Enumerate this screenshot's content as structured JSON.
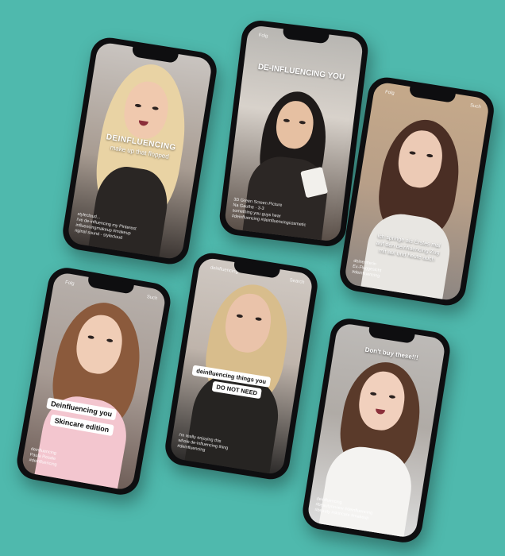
{
  "background_color": "#4fb9ad",
  "phones": [
    {
      "topbar": "",
      "title": "DEINFLUENCING",
      "subtitle": "make up that flopped",
      "caption": [
        "styleclaud...",
        "i've de-influencing my Pinterest",
        "influencingmakeup #makeup",
        "riginal sound - stylecloud"
      ]
    },
    {
      "topbar": "Folg",
      "title": "DE-INFLUENCING YOU",
      "caption": [
        "3D Green Screen Picture",
        "Na Gauthe · 3-3",
        "something you guys hear",
        "#deinfluencing #deinfluencingcosmetic"
      ]
    },
    {
      "topbar": "Folg",
      "topbar_right": "Such",
      "caption_text": [
        "ich springe als Erstes mal",
        "auf den deinfluencing Zug",
        "mit auf und heute auch"
      ],
      "caption": [
        "deineritterin",
        "Ex-Fluggesicht",
        "#deinfluencing"
      ]
    },
    {
      "topbar": "Folg",
      "topbar_right": "Such",
      "chips": [
        "Deinfluencing you",
        "Skincare edition"
      ],
      "caption": [
        "deinfluencing",
        "Paula Resale",
        "#deinfluencing"
      ]
    },
    {
      "topbar": "deinfluencing",
      "topbar_right": "Search",
      "chips": [
        "deinfluencing things you",
        "DO NOT NEED"
      ],
      "caption": [
        "i'm really enjoying this",
        "whole de-influencing thing",
        "#deinfluencing"
      ]
    },
    {
      "topbar": "",
      "chips": [
        "Don't buy these!!!"
      ],
      "caption": [
        "deinfluencing",
        "#beautyreview #deinfluencing",
        "#beauty #skincare #makeup"
      ]
    }
  ]
}
